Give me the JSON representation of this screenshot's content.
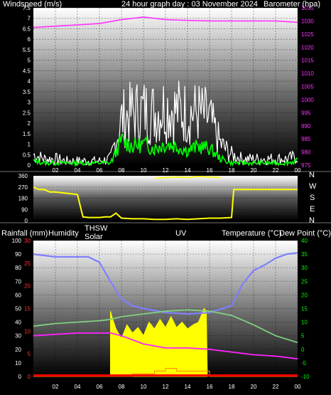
{
  "header": {
    "windspeed_label": "Windspeed (m/s)",
    "title": "24 hour graph day : 03 November 2024",
    "barometer_label": "Barometer (hpa)"
  },
  "compass": [
    "N",
    "W",
    "S",
    "E",
    "N"
  ],
  "middle_labels": {
    "rainfall": "Rainfall (mm)",
    "humidity": "Humidity",
    "thsw_line1": "THSW",
    "thsw_line2": "Solar",
    "uv": "UV",
    "temperature": "Temperature (°C)",
    "dewpoint": "Dew Point (°C)"
  },
  "colors": {
    "wind_gust": "#ffffff",
    "wind_avg": "#00ff00",
    "barometer": "#ff33ff",
    "wind_dir": "#ffff00",
    "temperature": "#7f7fff",
    "humidity": "#80d080",
    "dewpoint": "#ff22ff",
    "solar": "#ffff00",
    "uv": "#ff8800",
    "rain": "#ff0000",
    "rain_axis": "#ff3333",
    "temp_axis": "#00ff00"
  },
  "chart_data": [
    {
      "type": "line",
      "title": "24 hour graph day : 03 November 2024",
      "x_ticks": [
        "02",
        "04",
        "06",
        "08",
        "10",
        "12",
        "14",
        "16",
        "18",
        "20",
        "22",
        "00"
      ],
      "xlim": [
        0,
        24
      ],
      "y_left_label": "Windspeed (m/s)",
      "y_left_ticks": [
        "0",
        "0.5",
        "1",
        "1.5",
        "2",
        "2.5",
        "3",
        "3.5",
        "4",
        "4.5",
        "5",
        "5.5",
        "6",
        "6.5",
        "7",
        "7.5"
      ],
      "ylim_left": [
        0,
        7.5
      ],
      "y_right_label": "Barometer (hpa)",
      "y_right_ticks": [
        "975",
        "980",
        "985",
        "990",
        "995",
        "1000",
        "1005",
        "1010",
        "1015",
        "1020",
        "1025",
        "1030",
        "1035"
      ],
      "ylim_right": [
        975,
        1035
      ],
      "series": [
        {
          "name": "Windspeed",
          "axis": "left",
          "x": [
            0,
            1,
            2,
            3,
            4,
            5,
            6,
            7,
            7.5,
            8,
            9,
            10,
            11,
            12,
            13,
            14,
            15,
            16,
            17,
            18,
            19,
            20,
            21,
            22,
            23,
            24
          ],
          "values": [
            0.5,
            0.3,
            0.3,
            0.2,
            0.2,
            0.2,
            0.2,
            0.3,
            1.2,
            2.2,
            2.5,
            2.6,
            2.5,
            2.8,
            2.6,
            2.5,
            2.5,
            2.2,
            1.0,
            0.5,
            0.3,
            0.3,
            0.3,
            0.3,
            0.3,
            0.4
          ]
        },
        {
          "name": "Wind average",
          "axis": "left",
          "x": [
            0,
            1,
            2,
            3,
            4,
            5,
            6,
            7,
            7.5,
            8,
            9,
            10,
            11,
            12,
            13,
            14,
            15,
            16,
            17,
            18,
            19,
            20,
            21,
            22,
            23,
            24
          ],
          "values": [
            0.2,
            0.1,
            0.1,
            0.1,
            0.1,
            0.1,
            0.1,
            0.1,
            0.6,
            1.2,
            0.9,
            1.0,
            0.8,
            1.0,
            0.9,
            0.7,
            0.9,
            0.8,
            0.3,
            0.1,
            0.1,
            0.1,
            0.1,
            0.1,
            0.1,
            0.2
          ]
        },
        {
          "name": "Barometer",
          "axis": "right",
          "x": [
            0,
            2,
            4,
            6,
            8,
            10,
            12,
            14,
            16,
            18,
            20,
            22,
            24
          ],
          "values": [
            1027.5,
            1028.0,
            1028.5,
            1029.0,
            1030.5,
            1031.5,
            1030.5,
            1030.2,
            1030.0,
            1030.0,
            1030.0,
            1030.0,
            1029.5
          ]
        }
      ]
    },
    {
      "type": "scatter",
      "x_ticks": [],
      "xlim": [
        0,
        24
      ],
      "y_ticks": [
        "0",
        "90",
        "180",
        "270",
        "360"
      ],
      "ylim": [
        0,
        360
      ],
      "series": [
        {
          "name": "Wind direction",
          "x": [
            0,
            0.5,
            1,
            1.5,
            2,
            3,
            4,
            4.5,
            5,
            5.5,
            6,
            6.5,
            7,
            7.5,
            8,
            9,
            10,
            11,
            12,
            13,
            14,
            15,
            16,
            17,
            18,
            18.2,
            19,
            20,
            21,
            22,
            23,
            24
          ],
          "values": [
            270,
            250,
            250,
            230,
            230,
            220,
            210,
            30,
            25,
            25,
            25,
            30,
            30,
            60,
            20,
            15,
            15,
            10,
            10,
            15,
            10,
            15,
            20,
            20,
            25,
            250,
            250,
            250,
            250,
            250,
            250,
            250
          ]
        },
        {
          "name": "Wind direction (northerly)",
          "x": [
            11,
            12,
            13,
            14,
            15,
            16,
            17
          ],
          "values": [
            340,
            345,
            350,
            345,
            355,
            350,
            345
          ]
        }
      ]
    },
    {
      "type": "line",
      "xlim": [
        0,
        24
      ],
      "x_ticks": [
        "02",
        "04",
        "06",
        "08",
        "10",
        "12",
        "14",
        "16",
        "18",
        "20",
        "22",
        "00"
      ],
      "y_humidity_ticks": [
        "0",
        "10",
        "20",
        "30",
        "40",
        "50",
        "60",
        "70",
        "80",
        "90",
        "100"
      ],
      "y_rain_ticks": [
        "0",
        "5",
        "10",
        "15",
        "20",
        "25",
        "30"
      ],
      "y_temp_ticks": [
        "-10",
        "-5",
        "0",
        "5",
        "10",
        "15",
        "20",
        "25",
        "30",
        "35",
        "40"
      ],
      "ylim_humidity": [
        0,
        100
      ],
      "ylim_rain": [
        0,
        30
      ],
      "ylim_temp": [
        -10,
        40
      ],
      "series": [
        {
          "name": "Humidity",
          "axis": "humidity",
          "x": [
            0,
            2,
            4,
            5,
            6,
            7,
            8,
            9,
            10,
            12,
            14,
            16,
            18,
            19,
            20,
            21,
            22,
            23,
            24
          ],
          "values": [
            90,
            88,
            88,
            88,
            84,
            70,
            57,
            52,
            50,
            47,
            46,
            47,
            52,
            68,
            78,
            82,
            87,
            90,
            91
          ]
        },
        {
          "name": "Temperature",
          "axis": "humidity",
          "x": [
            0,
            2,
            4,
            6,
            7,
            8,
            10,
            12,
            14,
            16,
            18,
            20,
            22,
            24
          ],
          "values": [
            37,
            39,
            40,
            41,
            42,
            44,
            46,
            48,
            49,
            48,
            45,
            38,
            30,
            25
          ]
        },
        {
          "name": "Dew Point",
          "axis": "humidity",
          "x": [
            0,
            2,
            4,
            6,
            7,
            8,
            10,
            12,
            14,
            16,
            18,
            20,
            22,
            24
          ],
          "values": [
            30,
            31,
            32,
            32,
            32,
            30,
            24,
            21,
            21,
            20,
            18,
            16,
            15,
            13
          ]
        },
        {
          "name": "Solar",
          "axis": "humidity",
          "x": [
            7,
            7.1,
            7.3,
            7.5,
            8,
            8.5,
            9,
            9.5,
            10,
            10.5,
            11,
            11.5,
            12,
            12.5,
            13,
            13.5,
            14,
            14.5,
            15,
            15.5,
            15.7,
            15.8
          ],
          "values": [
            48,
            45,
            40,
            35,
            28,
            38,
            32,
            36,
            30,
            40,
            35,
            42,
            36,
            44,
            36,
            40,
            35,
            38,
            40,
            50,
            48,
            0
          ]
        },
        {
          "name": "UV",
          "axis": "humidity",
          "x": [
            0,
            8,
            9,
            10,
            11,
            12,
            13,
            14,
            15,
            16,
            24
          ],
          "values": [
            0,
            0,
            2,
            2,
            4,
            6,
            4,
            4,
            4,
            0,
            0
          ]
        },
        {
          "name": "Rainfall",
          "axis": "rain",
          "x": [
            0,
            24
          ],
          "values": [
            0,
            0
          ]
        }
      ]
    }
  ]
}
